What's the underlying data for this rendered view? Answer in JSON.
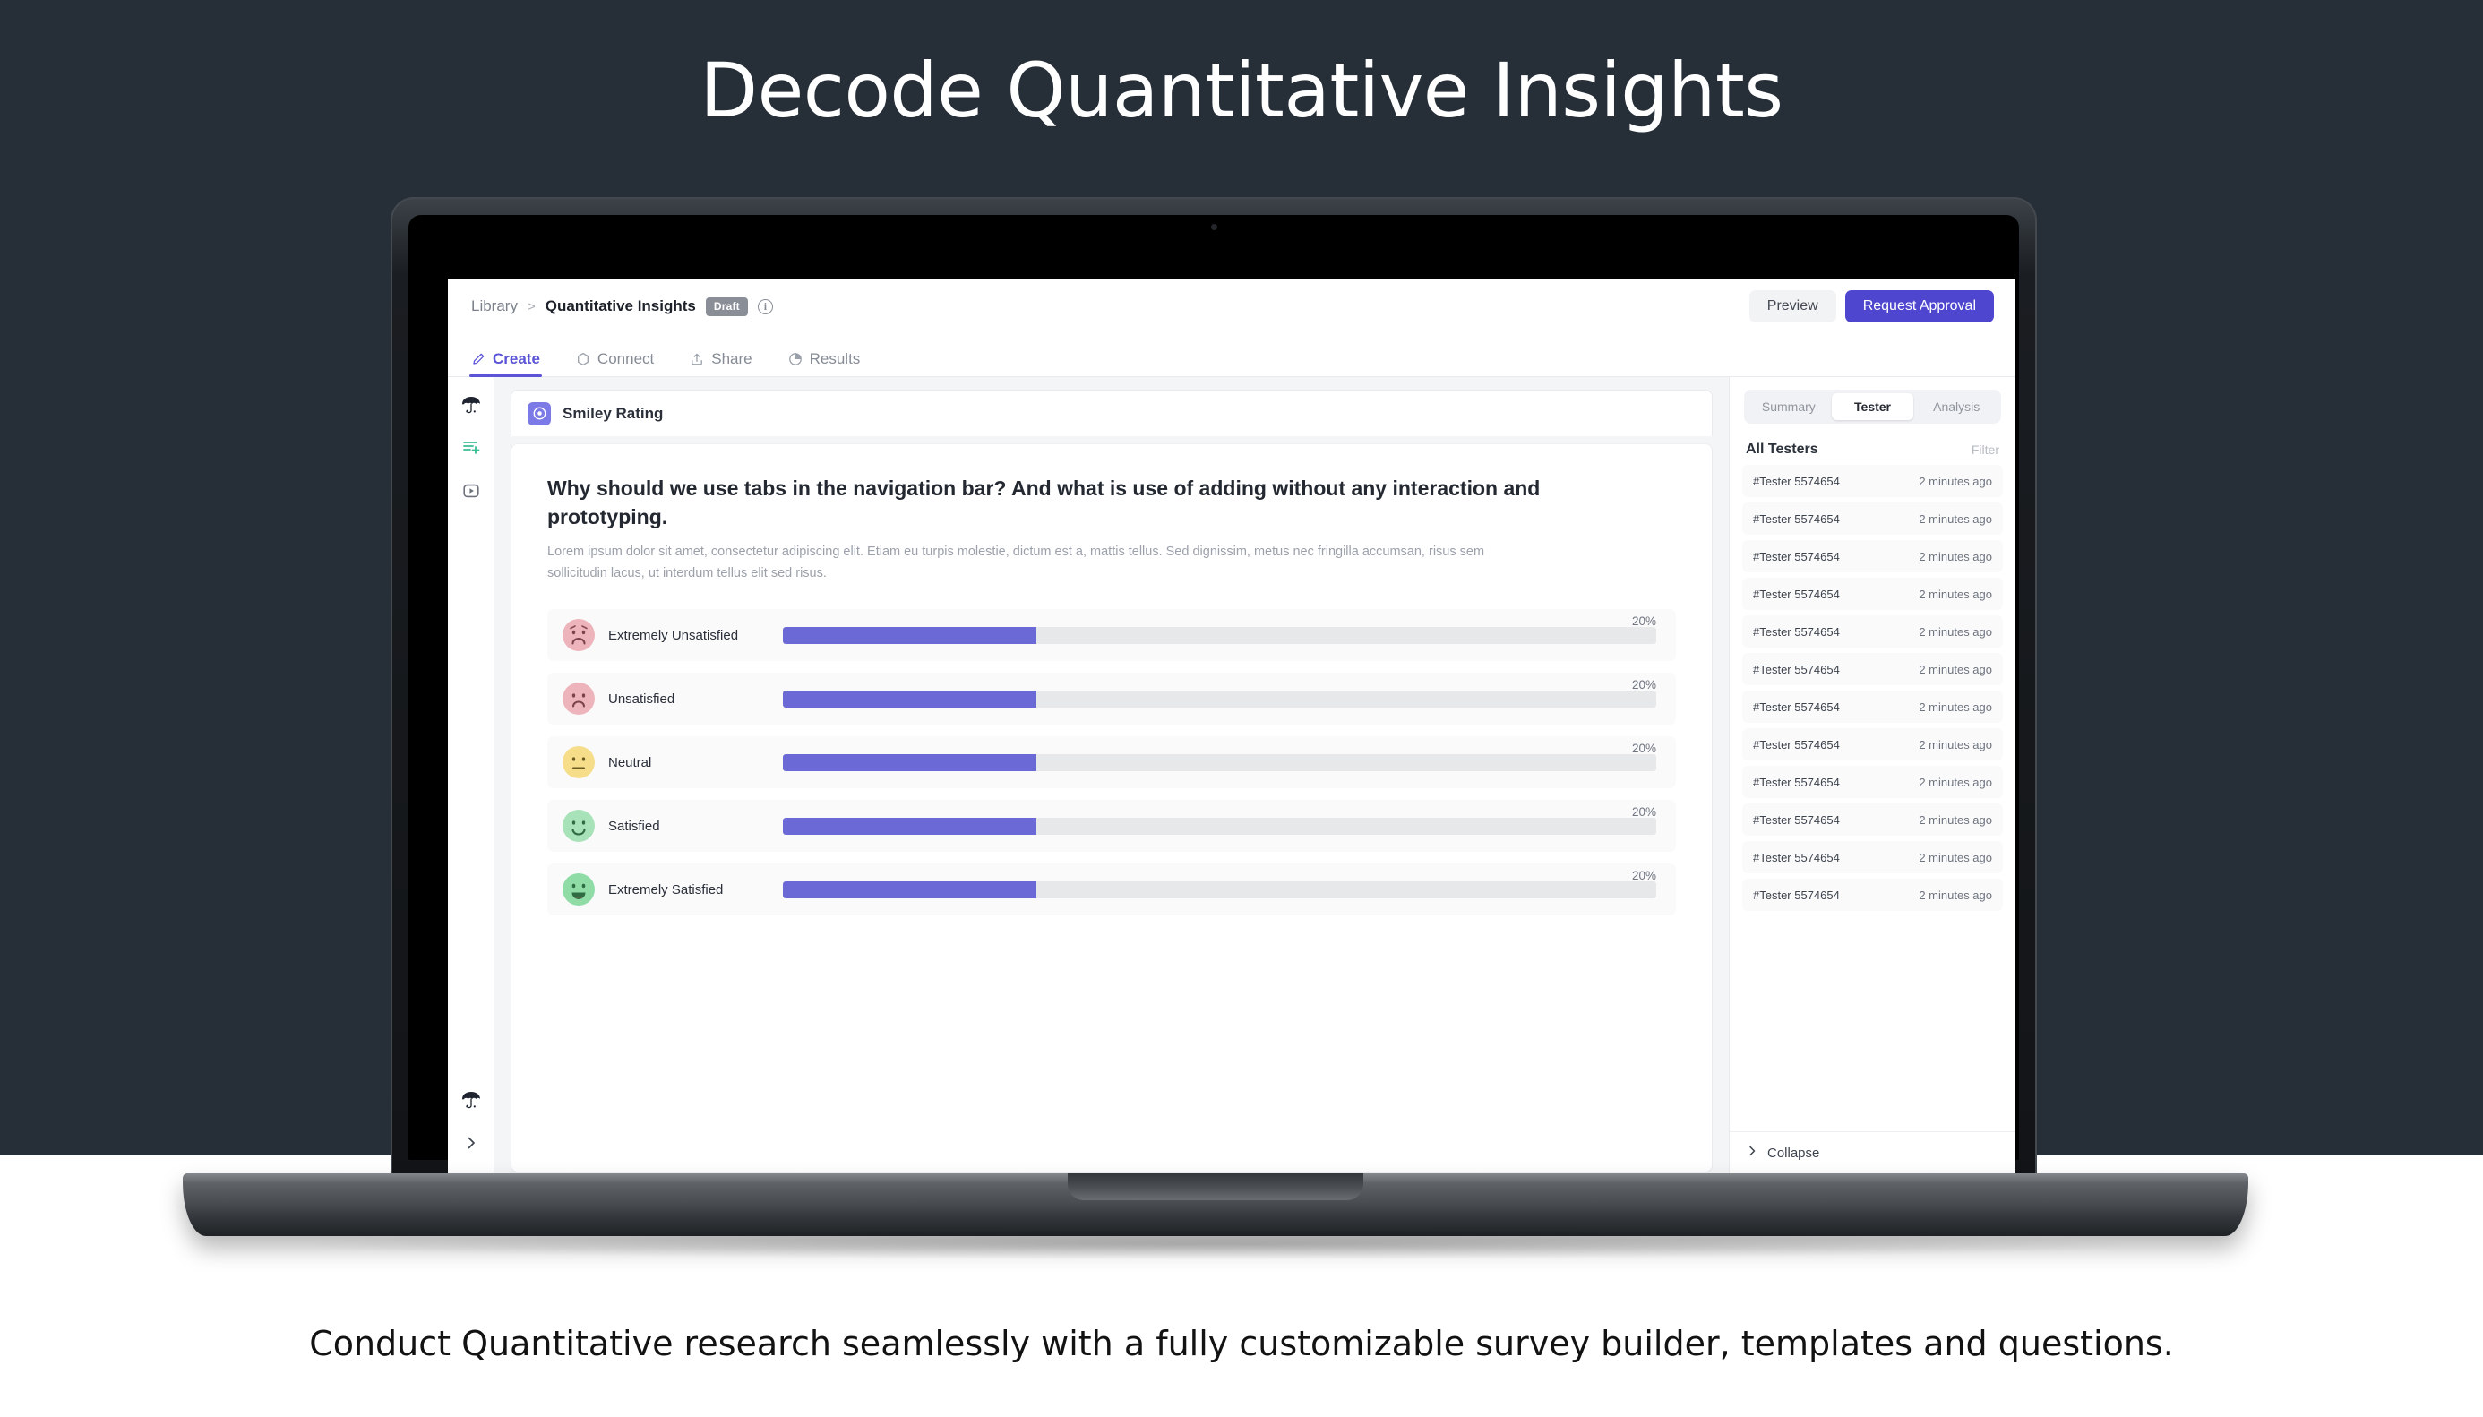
{
  "hero": {
    "title": "Decode Quantitative Insights",
    "background_color": "#262e38"
  },
  "caption": "Conduct Quantitative research seamlessly with a fully customizable survey builder, templates and questions.",
  "app": {
    "breadcrumb": {
      "root": "Library",
      "separator": ">",
      "current": "Quantitative Insights",
      "badge": "Draft",
      "info_icon": "info-icon"
    },
    "actions": {
      "preview": "Preview",
      "request_approval": "Request Approval",
      "accent_color": "#4f46cf"
    },
    "tabs": [
      {
        "label": "Create",
        "icon": "pencil-icon",
        "active": true
      },
      {
        "label": "Connect",
        "icon": "hexagon-icon",
        "active": false
      },
      {
        "label": "Share",
        "icon": "upload-icon",
        "active": false
      },
      {
        "label": "Results",
        "icon": "pie-chart-icon",
        "active": false
      }
    ],
    "left_rail": [
      {
        "icon": "umbrella-logo-icon"
      },
      {
        "icon": "add-to-list-icon"
      },
      {
        "icon": "play-media-icon"
      },
      {
        "icon": "umbrella-logo-icon"
      },
      {
        "icon": "chevron-right-icon"
      }
    ],
    "card": {
      "icon": "smiley-rating-icon",
      "title": "Smiley Rating",
      "question": "Why should we use tabs in the navigation bar? And what is use of adding without any interaction and prototyping.",
      "description": "Lorem ipsum dolor sit amet, consectetur adipiscing elit. Etiam eu turpis molestie, dictum est a, mattis tellus. Sed dignissim, metus nec fringilla accumsan, risus sem sollicitudin lacus, ut interdum tellus elit sed risus."
    },
    "right_panel": {
      "segments": [
        {
          "label": "Summary",
          "active": false
        },
        {
          "label": "Tester",
          "active": true
        },
        {
          "label": "Analysis",
          "active": false
        }
      ],
      "list_title": "All Testers",
      "filter_label": "Filter",
      "testers": [
        {
          "id": "#Tester 5574654",
          "time": "2 minutes ago"
        },
        {
          "id": "#Tester 5574654",
          "time": "2 minutes ago"
        },
        {
          "id": "#Tester 5574654",
          "time": "2 minutes ago"
        },
        {
          "id": "#Tester 5574654",
          "time": "2 minutes ago"
        },
        {
          "id": "#Tester 5574654",
          "time": "2 minutes ago"
        },
        {
          "id": "#Tester 5574654",
          "time": "2 minutes ago"
        },
        {
          "id": "#Tester 5574654",
          "time": "2 minutes ago"
        },
        {
          "id": "#Tester 5574654",
          "time": "2 minutes ago"
        },
        {
          "id": "#Tester 5574654",
          "time": "2 minutes ago"
        },
        {
          "id": "#Tester 5574654",
          "time": "2 minutes ago"
        },
        {
          "id": "#Tester 5574654",
          "time": "2 minutes ago"
        },
        {
          "id": "#Tester 5574654",
          "time": "2 minutes ago"
        }
      ],
      "collapse_label": "Collapse",
      "collapse_icon": "chevron-right-icon"
    }
  },
  "chart_data": {
    "type": "bar",
    "title": "Smiley Rating",
    "orientation": "horizontal",
    "categories": [
      "Extremely Unsatisfied",
      "Unsatisfied",
      "Neutral",
      "Satisfied",
      "Extremely Satisfied"
    ],
    "values": [
      20,
      20,
      20,
      20,
      20
    ],
    "value_labels": [
      "20%",
      "20%",
      "20%",
      "20%",
      "20%"
    ],
    "bar_fill_fraction": [
      0.29,
      0.29,
      0.29,
      0.29,
      0.29
    ],
    "unit": "%",
    "xlim": [
      0,
      100
    ],
    "grid": false,
    "legend": false,
    "series_color": "#6b69d6",
    "track_color": "#e7e8ea",
    "face_colors": [
      "#edb4bb",
      "#edb4bb",
      "#f6dd8a",
      "#a8e2b8",
      "#8fdca7"
    ],
    "face_moods": [
      "very-sad",
      "sad",
      "neutral",
      "happy",
      "very-happy"
    ]
  }
}
